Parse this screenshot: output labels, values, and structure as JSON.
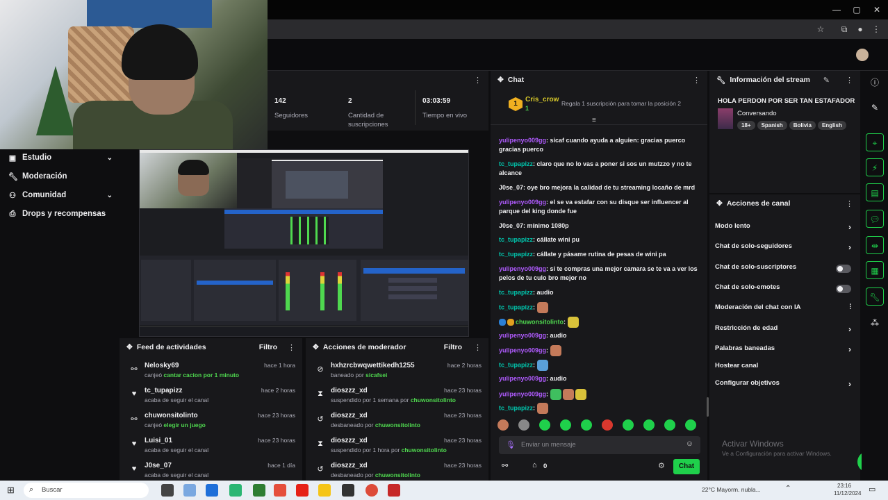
{
  "browser": {
    "window_controls": [
      "—",
      "▢",
      "✕"
    ]
  },
  "leftnav": {
    "items": [
      {
        "label": "Estudio",
        "icon": "video-icon",
        "chevron": true
      },
      {
        "label": "Moderación",
        "icon": "wrench-icon",
        "chevron": false
      },
      {
        "label": "Comunidad",
        "icon": "people-icon",
        "chevron": true
      },
      {
        "label": "Drops y recompensas",
        "icon": "gift-icon",
        "chevron": false
      }
    ]
  },
  "stats": {
    "followers_value": "142",
    "followers_label": "Seguidores",
    "subs_value": "2",
    "subs_label": "Cantidad de suscripciones",
    "uptime_value": "03:03:59",
    "uptime_label": "Tiempo en vivo"
  },
  "chat": {
    "title": "Chat",
    "pinned_user": "Cris_crow",
    "pinned_badge": "1",
    "pinned_text": "Regala 1 suscripción para tomar la posición 2",
    "messages": [
      {
        "user": "yulipenyo009gg",
        "color": "purple",
        "text": "sicaf cuando ayuda a alguien: gracias puerco gracias puerco"
      },
      {
        "user": "tc_tupapizz",
        "color": "cyan",
        "text": "claro que no lo vas a poner si sos un mutzzo y no te alcance"
      },
      {
        "user": "J0se_07",
        "color": "plain",
        "text": "oye bro mejora la calidad de tu streaming locaño de mrd"
      },
      {
        "user": "yulipenyo009gg",
        "color": "purple",
        "text": "el se va estafar con su disque ser influencer al parque del king donde fue"
      },
      {
        "user": "J0se_07",
        "color": "plain",
        "text": "mínimo 1080p"
      },
      {
        "user": "tc_tupapizz",
        "color": "cyan",
        "text": "cállate wini pu"
      },
      {
        "user": "tc_tupapizz",
        "color": "cyan",
        "text": "cállate y pásame rutina de pesas de wini pa"
      },
      {
        "user": "yulipenyo009gg",
        "color": "purple",
        "text": "si te compras una mejor camara se te va a ver los pelos de tu culo bro mejor no"
      },
      {
        "user": "tc_tupapizz",
        "color": "cyan",
        "text": "audio"
      },
      {
        "user": "tc_tupapizz",
        "color": "cyan",
        "text": ""
      },
      {
        "user": "chuwonsitolinto",
        "color": "green",
        "text": ""
      },
      {
        "user": "yulipenyo009gg",
        "color": "purple",
        "text": "audio"
      },
      {
        "user": "yulipenyo009gg",
        "color": "purple",
        "text": ""
      },
      {
        "user": "tc_tupapizz",
        "color": "cyan",
        "text": ""
      },
      {
        "user": "yulipenyo009gg",
        "color": "purple",
        "text": "audio"
      },
      {
        "user": "yulipenyo009gg",
        "color": "purple",
        "text": ""
      },
      {
        "user": "tc_tupapizz",
        "color": "cyan",
        "text": ""
      }
    ],
    "input_placeholder": "Enviar un mensaje",
    "points": "0",
    "send_label": "Chat"
  },
  "stream_info": {
    "title": "Información del stream",
    "stream_title": "HOLA PERDON POR SER TAN ESTAFADOR",
    "category": "Conversando",
    "tags": [
      "18+",
      "Spanish",
      "Bolivia",
      "English"
    ]
  },
  "channel_actions": {
    "title": "Acciones de canal",
    "items": [
      {
        "label": "Modo lento",
        "type": "chevron"
      },
      {
        "label": "Chat de solo-seguidores",
        "type": "chevron"
      },
      {
        "label": "Chat de solo-suscriptores",
        "type": "toggle"
      },
      {
        "label": "Chat de solo-emotes",
        "type": "toggle"
      },
      {
        "label": "Moderación del chat con IA",
        "type": "chart"
      },
      {
        "label": "Restricción de edad",
        "type": "chevron"
      },
      {
        "label": "Palabras baneadas",
        "type": "chevron"
      },
      {
        "label": "Hostear canal",
        "type": "none"
      },
      {
        "label": "Configurar objetivos",
        "type": "chevron"
      }
    ]
  },
  "activity": {
    "title": "Feed de actividades",
    "filter": "Filtro",
    "rows": [
      {
        "name": "Nelosky69",
        "sub_pre": "canjeó ",
        "sub_hl": "cantar cacion por 1 minuto",
        "time": "hace 1 hora",
        "icon": "points-icon"
      },
      {
        "name": "tc_tupapizz",
        "sub_pre": "acaba de seguir el canal",
        "sub_hl": "",
        "time": "hace 2 horas",
        "icon": "heart-icon"
      },
      {
        "name": "chuwonsitolinto",
        "sub_pre": "canjeó ",
        "sub_hl": "elegir un juego",
        "time": "hace 23 horas",
        "icon": "points-icon"
      },
      {
        "name": "Luisi_01",
        "sub_pre": "acaba de seguir el canal",
        "sub_hl": "",
        "time": "hace 23 horas",
        "icon": "heart-icon"
      },
      {
        "name": "J0se_07",
        "sub_pre": "acaba de seguir el canal",
        "sub_hl": "",
        "time": "hace 1 día",
        "icon": "heart-icon"
      }
    ]
  },
  "modactions": {
    "title": "Acciones de moderador",
    "filter": "Filtro",
    "rows": [
      {
        "name": "hxhzrcbwqwettikedh1255",
        "sub_pre": "baneado por ",
        "sub_hl": "sicafsei",
        "time": "hace 2 horas",
        "icon": "ban-icon"
      },
      {
        "name": "dioszzz_xd",
        "sub_pre": "suspendido por 1 semana por ",
        "sub_hl": "chuwonsitolinto",
        "time": "hace 23 horas",
        "icon": "hourglass-icon"
      },
      {
        "name": "dioszzz_xd",
        "sub_pre": "desbaneado por ",
        "sub_hl": "chuwonsitolinto",
        "time": "hace 23 horas",
        "icon": "undo-icon"
      },
      {
        "name": "dioszzz_xd",
        "sub_pre": "suspendido por 1 hora por ",
        "sub_hl": "chuwonsitolinto",
        "time": "hace 23 horas",
        "icon": "hourglass-icon"
      },
      {
        "name": "dioszzz_xd",
        "sub_pre": "desbaneado por ",
        "sub_hl": "chuwonsitolinto",
        "time": "hace 23 horas",
        "icon": "undo-icon"
      }
    ]
  },
  "watermark": {
    "line1": "Activar Windows",
    "line2": "Ve a Configuración para activar Windows."
  },
  "taskbar": {
    "search_placeholder": "Buscar",
    "weather": "22°C  Mayorm. nubla...",
    "time": "23:16",
    "date": "11/12/2024"
  },
  "colors": {
    "accent_green": "#1fd04b",
    "panel_bg": "#18181b",
    "page_bg": "#0e0e10",
    "user_purple": "#b05bff",
    "user_cyan": "#00c8af"
  }
}
